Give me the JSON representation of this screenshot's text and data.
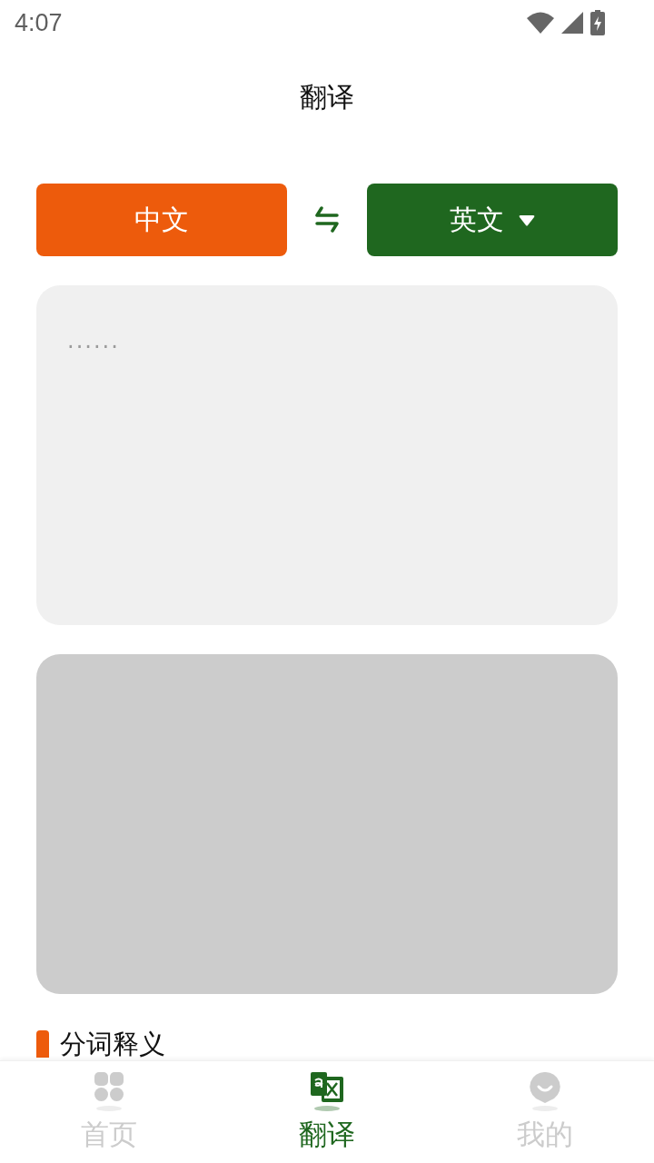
{
  "status_bar": {
    "time": "4:07"
  },
  "header": {
    "title": "翻译"
  },
  "languages": {
    "source": {
      "label": "中文"
    },
    "target": {
      "label": "英文"
    }
  },
  "input": {
    "placeholder": "······"
  },
  "section": {
    "title": "分词释义"
  },
  "tabs": [
    {
      "kind": "home",
      "label": "首页",
      "selected": false
    },
    {
      "kind": "translate",
      "label": "翻译",
      "selected": true
    },
    {
      "kind": "profile",
      "label": "我的",
      "selected": false
    }
  ]
}
